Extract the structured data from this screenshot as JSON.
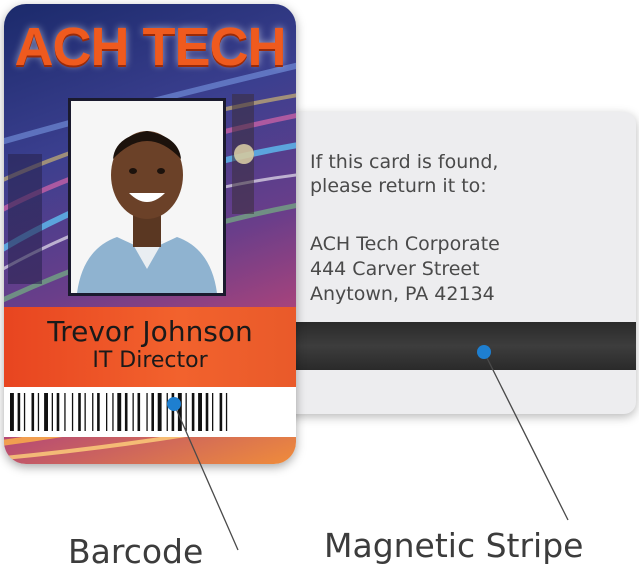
{
  "front": {
    "company": "ACH TECH",
    "name": "Trevor Johnson",
    "title": "IT Director"
  },
  "back": {
    "return_note": [
      "If this card is found,",
      "please return it to:"
    ],
    "address": [
      "ACH Tech Corporate",
      "444 Carver Street",
      "Anytown, PA 42134"
    ]
  },
  "callouts": {
    "barcode": "Barcode",
    "magnetic_stripe": "Magnetic Stripe"
  },
  "colors": {
    "accent_orange": "#ef5a1e",
    "callout_dot": "#1e7fd0",
    "stripe": "#333333",
    "card_back": "#ededef"
  }
}
